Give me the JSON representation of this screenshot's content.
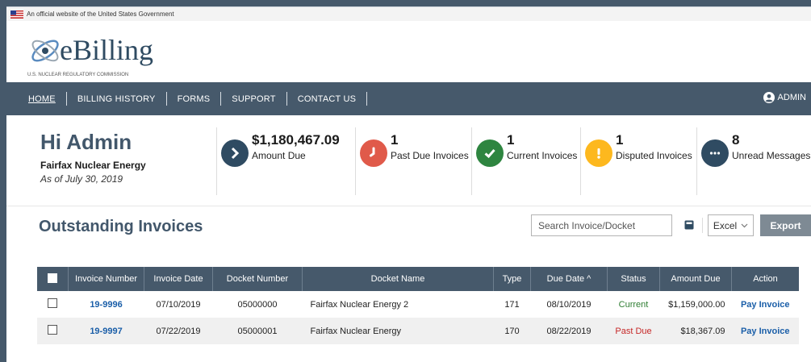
{
  "gov_banner": "An official website of the United States Government",
  "logo": {
    "text": "eBilling",
    "subtext": "U.S. NUCLEAR REGULATORY COMMISSION"
  },
  "nav": {
    "items": [
      "HOME",
      "BILLING HISTORY",
      "FORMS",
      "SUPPORT",
      "CONTACT US"
    ],
    "user": "ADMIN"
  },
  "greeting": {
    "hello": "Hi Admin",
    "org": "Fairfax Nuclear Energy",
    "as_of": "As of July 30, 2019"
  },
  "stats": [
    {
      "value": "$1,180,467.09",
      "label": "Amount Due",
      "icon": "chevron-right-icon",
      "color": "#2f4b62"
    },
    {
      "value": "1",
      "label": "Past Due Invoices",
      "icon": "clock-icon",
      "color": "#e05a4a"
    },
    {
      "value": "1",
      "label": "Current Invoices",
      "icon": "check-icon",
      "color": "#2e8540"
    },
    {
      "value": "1",
      "label": "Disputed Invoices",
      "icon": "exclamation-icon",
      "color": "#fdb81e"
    },
    {
      "value": "8",
      "label": "Unread Messages",
      "icon": "chat-icon",
      "color": "#2f4b62"
    }
  ],
  "invoices": {
    "title": "Outstanding Invoices",
    "search_placeholder": "Search Invoice/Docket",
    "format": "Excel",
    "export_label": "Export",
    "columns": [
      "Invoice Number",
      "Invoice Date",
      "Docket Number",
      "Docket Name",
      "Type",
      "Due Date ^",
      "Status",
      "Amount Due",
      "Action"
    ],
    "rows": [
      {
        "invoice": "19-9996",
        "date": "07/10/2019",
        "docket": "05000000",
        "name": "Fairfax Nuclear Energy 2",
        "type": "171",
        "due": "08/10/2019",
        "status": "Current",
        "amount": "$1,159,000.00",
        "action": "Pay Invoice"
      },
      {
        "invoice": "19-9997",
        "date": "07/22/2019",
        "docket": "05000001",
        "name": "Fairfax Nuclear Energy",
        "type": "170",
        "due": "08/22/2019",
        "status": "Past Due",
        "amount": "$18,367.09",
        "action": "Pay Invoice"
      }
    ]
  }
}
